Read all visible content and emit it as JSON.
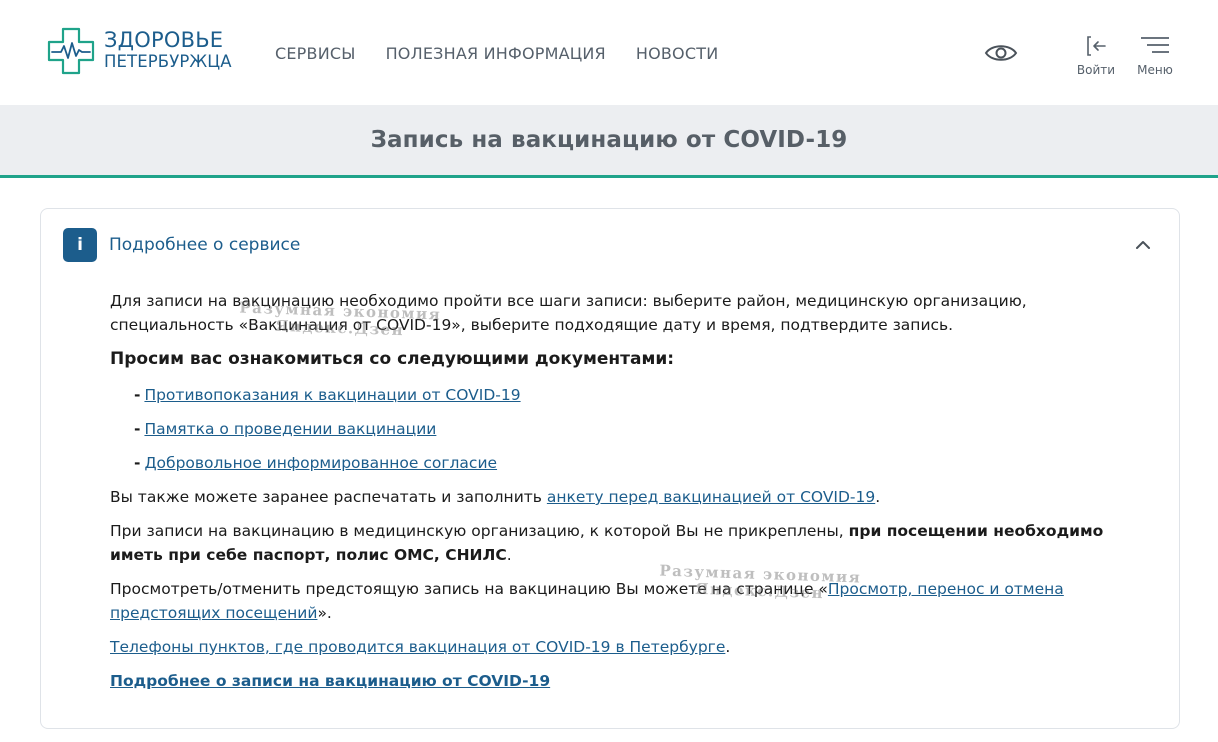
{
  "brand": {
    "line1": "ЗДОРОВЬЕ",
    "line2": "ПЕТЕРБУРЖЦА",
    "color": "#1c5d8c",
    "accent": "#1fa38a"
  },
  "nav": {
    "items": [
      {
        "label": "СЕРВИСЫ"
      },
      {
        "label": "ПОЛЕЗНАЯ ИНФОРМАЦИЯ"
      },
      {
        "label": "НОВОСТИ"
      }
    ]
  },
  "header_actions": {
    "accessibility_icon": "eye-icon",
    "login_label": "Войти",
    "login_icon": "login-icon",
    "menu_label": "Меню",
    "menu_icon": "hamburger-icon"
  },
  "page": {
    "title": "Запись на вакцинацию от COVID-19"
  },
  "info_panel": {
    "badge": "i",
    "title": "Подробнее о сервисе",
    "collapse_icon": "chevron-up-icon",
    "intro": "Для записи на вакцинацию необходимо пройти все шаги записи: выберите район, медицинскую организацию, специальность «Вакцинация от COVID-19», выберите подходящие дату и время, подтвердите запись.",
    "docs_heading": "Просим вас ознакомиться со следующими документами:",
    "docs": [
      {
        "dash": "-",
        "label": "Противопоказания к вакцинации от COVID-19"
      },
      {
        "dash": "-",
        "label": "Памятка о проведении вакцинации"
      },
      {
        "dash": "-",
        "label": "Добровольное информированное согласие"
      }
    ],
    "print_prefix": "Вы также можете заранее распечатать и заполнить ",
    "print_link": "анкету перед вакцинацией от COVID-19",
    "print_suffix": ".",
    "visit_prefix": "При записи на вакцинацию в медицинскую организацию, к которой Вы не прикреплены, ",
    "visit_bold": "при посещении необходимо иметь при себе паспорт, полис ОМС, СНИЛС",
    "visit_suffix": ".",
    "view_prefix": "Просмотреть/отменить предстоящую запись на вакцинацию Вы можете на странице «",
    "view_link": "Просмотр, перенос и отмена предстоящих посещений",
    "view_suffix": "».",
    "phones_link": "Телефоны пунктов, где проводится вакцинация от COVID-19 в Петербурге",
    "phones_suffix": ".",
    "more_link": "Подробнее о записи на вакцинацию от COVID-19"
  },
  "watermarks": [
    {
      "line1": "Разумная экономия",
      "line2": "Яндекс.Дзен"
    },
    {
      "line1": "Разумная экономия",
      "line2": "Яндекс.Дзен"
    }
  ]
}
